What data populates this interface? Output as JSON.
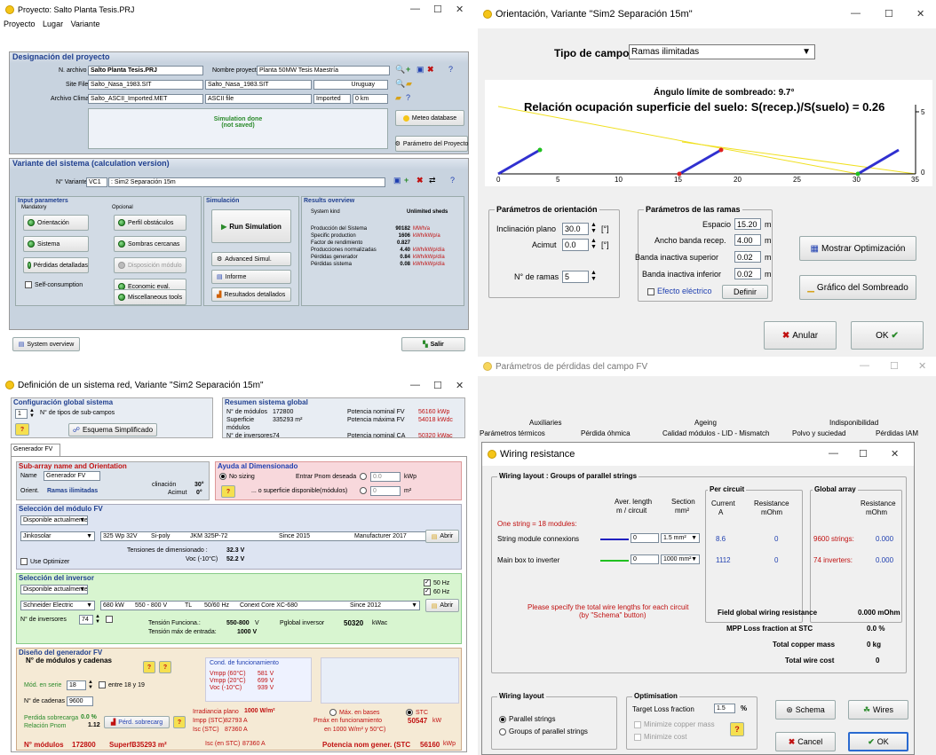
{
  "w1": {
    "title": "Proyecto: Salto Planta Tesis.PRJ",
    "menu": [
      "Proyecto",
      "Lugar",
      "Variante"
    ],
    "designacion": "Designación del proyecto",
    "narchivo_lbl": "N. archivo",
    "narchivo": "Salto Planta Tesis.PRJ",
    "nombre_lbl": "Nombre proyecto",
    "nombre": "Planta 50MW Tesis Maestría",
    "sitefile_lbl": "Site File",
    "sitefile": "Salto_Nasa_1983.SIT",
    "sitefile2": "Salto_Nasa_1983.SIT",
    "country": "Uruguay",
    "clima_lbl": "Archivo Clima",
    "clima": "Salto_ASCII_Imported.MET",
    "ascii": "ASCII file",
    "imported": "Imported",
    "km": "0 km",
    "sim_done": "Simulation done",
    "not_saved": "(not saved)",
    "meteo_btn": "Meteo database",
    "param_btn": "Parámetro del Proyecto",
    "variante_hdr": "Variante del sistema (calculation version)",
    "nvar_lbl": "N° Variante",
    "nvar": "VC1",
    "nvar_desc": ": Sim2 Separación 15m",
    "input_params": "Input parameters",
    "mandatory": "Mandatory",
    "optional": "Opcional",
    "simulation": "Simulación",
    "results": "Results overview",
    "b_orient": "Orientación",
    "b_sistema": "Sistema",
    "b_perdidas": "Pérdidas detalladas",
    "b_selfc": "Self-consumption",
    "b_perfil": "Perfil obstáculos",
    "b_sombras": "Sombras cercanas",
    "b_disp": "Disposición módulo",
    "b_econ": "Economic eval.",
    "b_misc": "Miscellaneous tools",
    "b_run": "Run Simulation",
    "b_adv": "Advanced Simul.",
    "b_informe": "Informe",
    "b_res": "Resultados detallados",
    "syskind_lbl": "System kind",
    "syskind": "Unlimited sheds",
    "res": [
      {
        "k": "Producción del Sistema",
        "v": "90182",
        "u": "MWh/a"
      },
      {
        "k": "Specific production",
        "v": "1606",
        "u": "kWh/kWp/a"
      },
      {
        "k": "Factor de rendimiento",
        "v": "0.827",
        "u": ""
      },
      {
        "k": "Producciones normalizadas",
        "v": "4.40",
        "u": "kWh/kWp/día"
      },
      {
        "k": "Pérdidas generador",
        "v": "0.84",
        "u": "kWh/kWp/día"
      },
      {
        "k": "Pérdidas sistema",
        "v": "0.08",
        "u": "kWh/kWp/día"
      }
    ],
    "sysov_btn": "System overview",
    "salir_btn": "Salir"
  },
  "w2": {
    "title": "Orientación, Variante \"Sim2 Separación 15m\"",
    "tipo_lbl": "Tipo de campo",
    "tipo": "Ramas ilimitadas",
    "angulo": "Ángulo límite de sombreado:  9.7°",
    "relacion": "Relación ocupación superficie del suelo: S(recep.)/S(suelo) = 0.26",
    "xticks": [
      "0",
      "5",
      "10",
      "15",
      "20",
      "25",
      "30",
      "35"
    ],
    "yticks": [
      "0",
      "5"
    ],
    "orient_grp": "Parámetros de orientación",
    "incl_lbl": "Inclinación plano",
    "incl": "30.0",
    "incl_u": "[°]",
    "acim_lbl": "Acimut",
    "acim": "0.0",
    "acim_u": "[°]",
    "nramas_lbl": "N° de ramas",
    "nramas": "5",
    "ramas_grp": "Parámetros de las ramas",
    "esp_lbl": "Espacio",
    "esp": "15.20",
    "ancho_lbl": "Ancho banda recep.",
    "ancho": "4.00",
    "sup_lbl": "Banda inactiva superior",
    "sup": "0.02",
    "inf_lbl": "Banda inactiva inferior",
    "inf": "0.02",
    "m": "m",
    "efecto_lbl": "Efecto eléctrico",
    "definir_btn": "Definir",
    "mostrar_btn": "Mostrar Optimización",
    "grafico_btn": "Gráfico del Sombreado",
    "anular_btn": "Anular",
    "ok_btn": "OK"
  },
  "w3": {
    "title": "Definición de un sistema red, Variante  \"Sim2 Separación 15m\"",
    "config_hdr": "Configuración global sistema",
    "ntipos": "1",
    "ntipos_lbl": "N° de tipos de sub-campos",
    "esquema_btn": "Esquema Simplificado",
    "resumen_hdr": "Resumen sistema global",
    "resumen": [
      {
        "k": "N° de módulos",
        "v": "172800",
        "k2": "Potencia nominal FV",
        "v2": "56160 kWp"
      },
      {
        "k": "Superficie módulos",
        "v": "335293 m²",
        "k2": "Potencia máxima FV",
        "v2": "54018 kWdc"
      },
      {
        "k": "N° de inversores",
        "v": "74",
        "k2": "Potencia nominal CA",
        "v2": "50320 kWac"
      }
    ],
    "tab": "Generador FV",
    "subarray_hdr": "Sub-array name and Orientation",
    "name_lbl": "Name",
    "name": "Generador FV",
    "orient_lbl": "Orient.",
    "orient": "Ramas ilimitadas",
    "incl_lbl": "clinación",
    "incl": "30°",
    "acim_lbl": "Acimut",
    "acim": "0°",
    "ayuda_hdr": "Ayuda al Dimensionado",
    "nosizing": "No sizing",
    "entrar_pnom": "Entrar Pnom deseada",
    "pnom_v": "0.0",
    "kwp": "kWp",
    "superficie": "... o superficie disponible(módulos)",
    "sup_v": "0",
    "m2": "m²",
    "selmod_hdr": "Selección del módulo FV",
    "disp": "Disponible actualmente",
    "mod_maker": "Jinkosolar",
    "mod_model": "325 Wp 32V",
    "mod_tech": "Si-poly",
    "mod_name": "JKM 325P-72",
    "mod_since": "Since 2015",
    "mod_src": "Manufacturer 2017",
    "abrir": "Abrir",
    "tens_dim_lbl": "Tensiones de dimensionado :",
    "vmpp": "32.3 V",
    "voc_lbl": "Voc (-10°C)",
    "voc": "52.2 V",
    "useopt": "Use Optimizer",
    "selinv_hdr": "Selección del inversor",
    "inv_maker": "Schneider Electric",
    "inv_pow": "680 kW",
    "inv_range": "550 - 800 V",
    "inv_tl": "TL",
    "inv_hz": "50/60 Hz",
    "inv_name": "Conext Core XC-680",
    "inv_since": "Since 2012",
    "hz50": "50 Hz",
    "hz60": "60 Hz",
    "ninv_lbl": "N° de inversores",
    "ninv": "74",
    "tens_func_lbl": "Tensión Funciona.:",
    "tens_func": "550-800",
    "v": "V",
    "tens_max_lbl": "Tensión máx de entrada:",
    "tens_max": "1000 V",
    "pglob_lbl": "Pglobal inversor",
    "pglob": "50320",
    "kwac": "kWac",
    "diseno_hdr": "Diseño del generador FV",
    "nmod_cad": "N° de módulos y cadenas",
    "cond_lbl": "Cond. de funcionamiento",
    "cond": [
      {
        "k": "Vmpp (60°C)",
        "v": "581 V"
      },
      {
        "k": "Vmpp (20°C)",
        "v": "699 V"
      },
      {
        "k": "Voc (-10°C)",
        "v": "939 V"
      }
    ],
    "modserie_lbl": "Mód. en serie",
    "modserie": "18",
    "entre": "entre 18 y 19",
    "ncad_lbl": "N° de cadenas",
    "ncad": "9600",
    "irr_lbl": "Irradiancia plano",
    "irr": "1000 W/m²",
    "maxbases": "Máx. en bases",
    "stc": "STC",
    "impp_lbl": "Impp (STC)",
    "impp": "82793 A",
    "isc_lbl": "Isc (STC)",
    "isc": "87360 A",
    "pmax_lbl": "Pmáx en funcionamiento",
    "pmax_cond": "en 1000 W/m² y 50°C)",
    "pmax": "50547",
    "kw": "kW",
    "sobre_lbl": "Perdida sobrecarga",
    "sobre": "0.0 %",
    "rel_lbl": "Relación Pnom",
    "rel": "1.12",
    "perd_sob_btn": "Pérd. sobrecarg",
    "nmod_lbl": "N° módulos",
    "nmod": "172800",
    "superf_lbl": "Superfi",
    "superf": "335293 m²",
    "isc2_lbl": "Isc (en STC)",
    "isc2": "87360 A",
    "pnomgen_lbl": "Potencia nom gener. (STC",
    "pnomgen": "56160",
    "kwp2": "kWp"
  },
  "w4": {
    "title": "Parámetros de pérdidas del campo FV",
    "tabs1": [
      "Auxiliaries",
      "Ageing",
      "Indisponibilidad"
    ],
    "tabs2": [
      "Parámetros térmicos",
      "Pérdida óhmica",
      "Calidad módulos - LID - Mismatch",
      "Polvo y suciedad",
      "Pérdidas IAM"
    ]
  },
  "w5": {
    "title": "Wiring resistance",
    "layout_lbl": "Wiring layout :   Groups of parallel strings",
    "aver": "Aver. length",
    "aver2": "m / circuit",
    "section": "Section",
    "section_u": "mm²",
    "percircuit": "Per circuit",
    "current": "Current",
    "current_u": "A",
    "res": "Resistance",
    "res_u": "mOhm",
    "global": "Global array",
    "gres": "Resistance",
    "gres_u": "mOhm",
    "onestring": "One string = 18 modules:",
    "rows": [
      {
        "k": "String module connexions",
        "len": "0",
        "sec": "1.5 mm²",
        "cur": "8.6",
        "res": "0",
        "g": "9600 strings:",
        "gv": "0.000"
      },
      {
        "k": "Main box to inverter",
        "len": "0",
        "sec": "1000 mm²",
        "cur": "1112",
        "res": "0",
        "g": "74 inverters:",
        "gv": "0.000"
      }
    ],
    "please": "Please specify the total wire lengths for each circuit",
    "please2": "(by \"Schema\" button)",
    "fgwr_lbl": "Field global wiring resistance",
    "fgwr": "0.000 mOhm",
    "mpp_lbl": "MPP Loss fraction at  STC",
    "mpp": "0.0 %",
    "cm_lbl": "Total copper mass",
    "cm": "0 kg",
    "tw_lbl": "Total wire cost",
    "tw": "0",
    "wl_grp": "Wiring layout",
    "parallel": "Parallel strings",
    "groups": "Groups of parallel strings",
    "opt_grp": "Optimisation",
    "tlf_lbl": "Target Loss fraction",
    "tlf": "1.5",
    "pct": "%",
    "mincu": "Minimize copper mass",
    "mincost": "Minimize cost",
    "schema_btn": "Schema",
    "wires_btn": "Wires",
    "cancel_btn": "Cancel",
    "ok_btn": "OK"
  },
  "colors": {
    "accent": "#1f3f8f",
    "green": "#2d7a2d",
    "red": "#c01010"
  }
}
